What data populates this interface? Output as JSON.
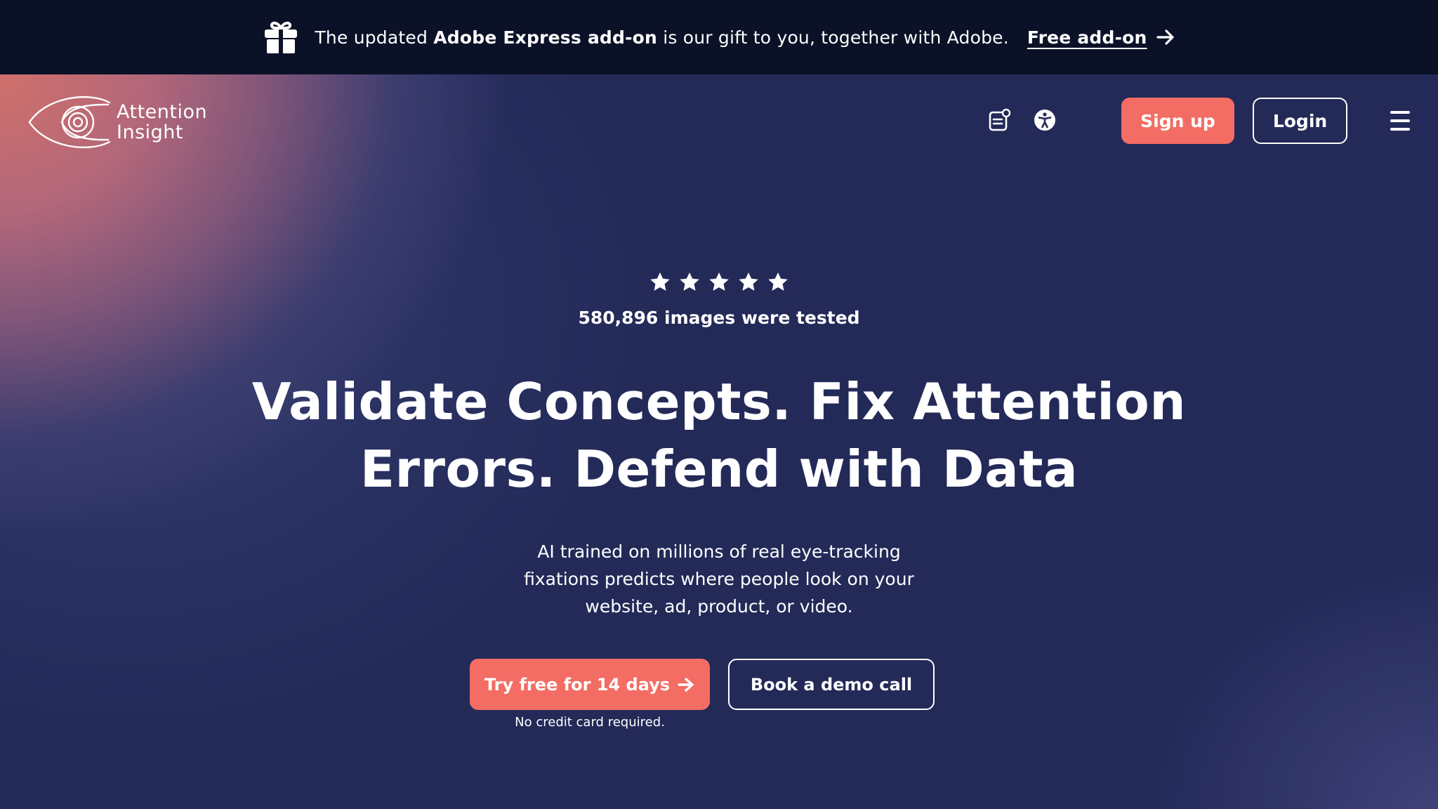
{
  "announcement": {
    "prefix": "The updated ",
    "highlight": "Adobe Express add-on",
    "suffix": " is our gift to you, together with Adobe.",
    "cta_label": "Free add-on",
    "gift_icon": "gift-icon",
    "arrow_icon": "arrow-right-icon"
  },
  "header": {
    "logo_line1": "Attention",
    "logo_line2": "Insight",
    "tool_icons": [
      "notes-icon",
      "accessibility-icon"
    ],
    "signup_label": "Sign up",
    "login_label": "Login",
    "menu_icon": "hamburger-menu-icon"
  },
  "hero": {
    "rating_stars": 5,
    "tested_text": "580,896 images were tested",
    "headline_line1": "Validate Concepts. Fix Attention",
    "headline_line2": "Errors. Defend with Data",
    "subcopy_line1": "AI trained on millions of real eye-tracking",
    "subcopy_line2": "fixations predicts where people look on your",
    "subcopy_line3": "website, ad, product, or video.",
    "primary_cta": "Try free for 14 days",
    "secondary_cta": "Book a demo call",
    "note": "No credit card required."
  },
  "colors": {
    "announcement_bg": "#0b1127",
    "hero_bg": "#232a58",
    "accent": "#f36d64",
    "gradient_corner": "#d0706b",
    "text": "#ffffff"
  }
}
